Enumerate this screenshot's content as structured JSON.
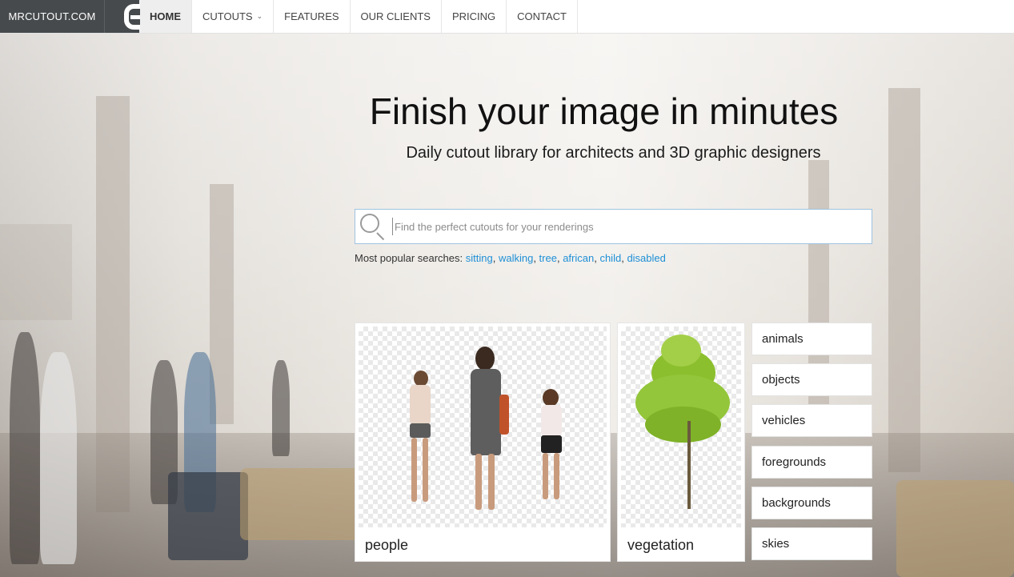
{
  "nav": {
    "brand": "MRCUTOUT.COM",
    "items": [
      {
        "label": "HOME",
        "active": true
      },
      {
        "label": "CUTOUTS",
        "has_dropdown": true
      },
      {
        "label": "FEATURES"
      },
      {
        "label": "OUR CLIENTS"
      },
      {
        "label": "PRICING"
      },
      {
        "label": "CONTACT"
      }
    ]
  },
  "hero": {
    "title": "Finish your image in minutes",
    "subtitle": "Daily cutout library for architects and 3D graphic designers"
  },
  "search": {
    "placeholder": "Find the perfect cutouts for your renderings",
    "value": ""
  },
  "popular": {
    "prefix": "Most popular searches:",
    "terms": [
      "sitting",
      "walking",
      "tree",
      "african",
      "child",
      "disabled"
    ]
  },
  "categories": {
    "featured": [
      {
        "label": "people"
      },
      {
        "label": "vegetation"
      }
    ],
    "links": [
      "animals",
      "objects",
      "vehicles",
      "foregrounds",
      "backgrounds",
      "skies"
    ]
  },
  "colors": {
    "brand_bg": "#464a4c",
    "link": "#1e8fd6",
    "search_border": "#9fc3df"
  }
}
